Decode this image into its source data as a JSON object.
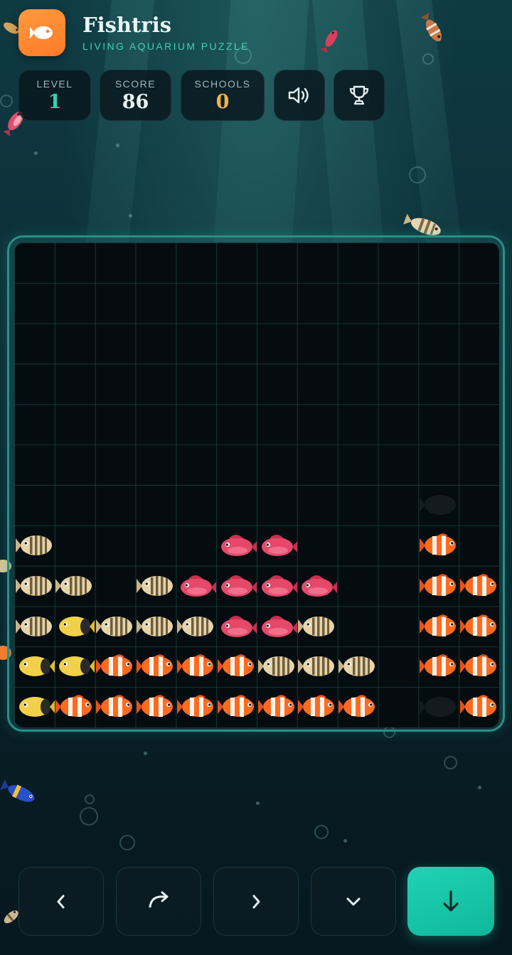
{
  "header": {
    "title": "Fishtris",
    "subtitle": "LIVING AQUARIUM PUZZLE"
  },
  "stats": {
    "level": {
      "label": "LEVEL",
      "value": "1"
    },
    "score": {
      "label": "SCORE",
      "value": "86"
    },
    "schools": {
      "label": "SCHOOLS",
      "value": "0"
    }
  },
  "icons": {
    "logo": "fish-icon",
    "sound": "speaker-icon",
    "trophy": "trophy-icon",
    "move_left": "chevron-left-icon",
    "rotate": "rotate-icon",
    "move_right": "chevron-right-icon",
    "soft_drop": "chevron-down-icon",
    "hard_drop": "arrow-down-icon"
  },
  "colors": {
    "accent": "#1fd3b3",
    "level_value": "#35d2b0",
    "score_value": "#e8f2f2",
    "schools_value": "#f2b441",
    "logo_bg": "#ff8a30"
  },
  "board": {
    "columns": 12,
    "rows": 12,
    "fish_types": {
      "Z": "zebra-fish",
      "Y": "yellow-fish",
      "P": "pink-fish",
      "C": "clownfish",
      "G": "ghost-preview"
    },
    "cells": [
      "............",
      "............",
      "............",
      "............",
      "............",
      "............",
      "..........G.",
      "Z....PP...C.",
      "ZZ.ZPPPP..CC",
      "ZYZZZPPZ..CC",
      "YYCCCCZZZ.CC",
      "YCCCCCCCC.GC"
    ]
  }
}
